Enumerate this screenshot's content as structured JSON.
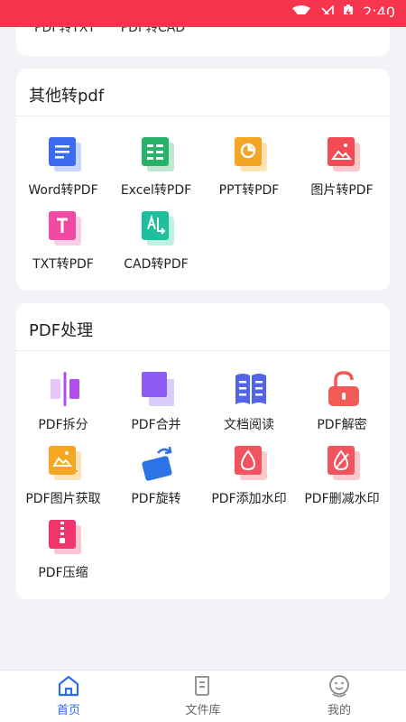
{
  "status": {
    "time": "2:40"
  },
  "top_card": {
    "items": [
      "PDF转TXT",
      "PDF转CAD"
    ]
  },
  "other_section": {
    "title": "其他转pdf",
    "tools": [
      {
        "label": "Word转PDF",
        "icon": "word-doc-icon",
        "color": "#3b6cf0"
      },
      {
        "label": "Excel转PDF",
        "icon": "excel-sheet-icon",
        "color": "#27b36a"
      },
      {
        "label": "PPT转PDF",
        "icon": "ppt-slide-icon",
        "color": "#f6a423"
      },
      {
        "label": "图片转PDF",
        "icon": "image-file-icon",
        "color": "#f14b55"
      },
      {
        "label": "TXT转PDF",
        "icon": "txt-file-icon",
        "color": "#f04aa4"
      },
      {
        "label": "CAD转PDF",
        "icon": "cad-file-icon",
        "color": "#1fbf9e"
      }
    ]
  },
  "pdf_section": {
    "title": "PDF处理",
    "tools": [
      {
        "label": "PDF拆分",
        "icon": "split-icon",
        "color": "#b04ff0"
      },
      {
        "label": "PDF合并",
        "icon": "merge-icon",
        "color": "#8e5cf4"
      },
      {
        "label": "文档阅读",
        "icon": "book-read-icon",
        "color": "#5264e8"
      },
      {
        "label": "PDF解密",
        "icon": "unlock-icon",
        "color": "#f25a55"
      },
      {
        "label": "PDF图片获取",
        "icon": "image-extract-icon",
        "color": "#f5a623"
      },
      {
        "label": "PDF旋转",
        "icon": "rotate-icon",
        "color": "#2d73e8"
      },
      {
        "label": "PDF添加水印",
        "icon": "add-watermark-icon",
        "color": "#f1545e"
      },
      {
        "label": "PDF删减水印",
        "icon": "remove-watermark-icon",
        "color": "#f1545e"
      },
      {
        "label": "PDF压缩",
        "icon": "compress-zip-icon",
        "color": "#f1356c"
      }
    ]
  },
  "tabbar": {
    "tabs": [
      {
        "label": "首页",
        "icon": "home-icon",
        "active": true
      },
      {
        "label": "文件库",
        "icon": "file-library-icon",
        "active": false
      },
      {
        "label": "我的",
        "icon": "profile-face-icon",
        "active": false
      }
    ]
  }
}
